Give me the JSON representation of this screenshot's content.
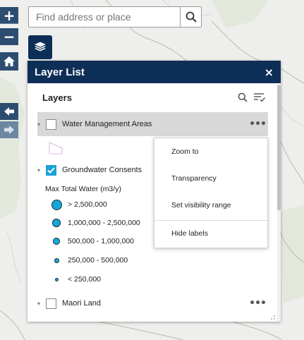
{
  "search": {
    "placeholder": "Find address or place"
  },
  "map_controls": {
    "zoom_in": "+",
    "zoom_out": "−",
    "home": "home-icon",
    "back": "arrow-left-icon",
    "forward": "arrow-right-icon",
    "layer_list": "layers-icon"
  },
  "panel": {
    "title": "Layer List",
    "close": "×",
    "layers_label": "Layers",
    "layers": [
      {
        "name": "Water Management Areas",
        "checked": false,
        "expanded": false,
        "highlighted": true
      },
      {
        "name": "Groundwater Consents",
        "checked": true,
        "expanded": true,
        "highlighted": false
      },
      {
        "name": "Maori Land",
        "checked": false,
        "expanded": false,
        "highlighted": false
      }
    ],
    "legend": {
      "title": "Max Total Water (m3/y)",
      "items": [
        {
          "label": "> 2,500,000"
        },
        {
          "label": "1,000,000 - 2,500,000"
        },
        {
          "label": "500,000 - 1,000,000"
        },
        {
          "label": "250,000 - 500,000"
        },
        {
          "label": "< 250,000"
        }
      ]
    },
    "more_options": "•••"
  },
  "context_menu": {
    "items": [
      {
        "label": "Zoom to"
      },
      {
        "label": "Transparency"
      },
      {
        "label": "Set visibility range"
      },
      {
        "label": "Hide labels"
      }
    ]
  },
  "colors": {
    "header_bg": "#0d2f57",
    "control_bg": "#2c4d70",
    "checkbox_on": "#1da1d8",
    "legend_fill": "#12a8dc",
    "highlight_row": "#d8d8d8"
  }
}
